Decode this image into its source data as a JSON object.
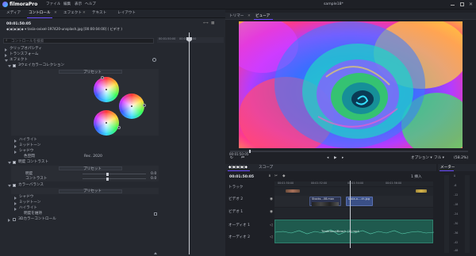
{
  "app": {
    "logo_text": "filmoraPro",
    "menu": [
      "ファイル",
      "編集",
      "表示",
      "ヘルプ"
    ],
    "project_name": "sample18*"
  },
  "left_tabs": [
    "メディア",
    "コントロール",
    "エフェクト",
    "テキスト",
    "レイアウト"
  ],
  "left_tab_active": "コントロール",
  "left_time": "00:01:50:05",
  "left_subtitle": "◆|◆|◆|◆|◆  ▾  tasia-ovixel-197420-unsplash.jpg [00:00:04:00] ( ビデオ )",
  "ruler": [
    "00:01:50:00",
    "00:01:52:00"
  ],
  "search_placeholder": "コントロールを検索",
  "controls": {
    "clip_opacity": "クリップオパシティ",
    "transform": "トランスフォーム",
    "effects": "エフェクト",
    "three_way": "3ウェイカラーコレクション",
    "preset": "プリセット",
    "highlight": "ハイライト",
    "midtone": "ミッドトーン",
    "shadow": "シャドウ",
    "color_space": "色空間",
    "color_space_value": "Rec. 2020",
    "brightness_contrast": "明度 コントラスト",
    "brightness": "明度",
    "contrast": "コントラスト",
    "zero": "0.0",
    "color_balance": "カラーバランス",
    "shadow2": "シャドウ",
    "midtone2": "ミッドトーン",
    "highlight2": "ハイライト",
    "keep_brightness": "明度を維持",
    "lut": "3Dカラーコントロール"
  },
  "viewer_tabs": [
    "トリマー",
    "ビューア"
  ],
  "viewer_tab_active": "ビューア",
  "viewer_time": "00:01:50:05",
  "viewer_options": "オプション ▾",
  "viewer_full": "フル ▾",
  "viewer_zoom": "(58.2%)",
  "timeline": {
    "tab_label": "◆|◆|◆|◆|◆",
    "scope": "スコープ",
    "time": "00:01:50:05",
    "cut_label": "1 挿入",
    "ruler": [
      "00:01:50:00",
      "00:01:52:00",
      "00:01:54:00",
      "00:01:56:00"
    ],
    "tracks": [
      {
        "name": "トラック"
      },
      {
        "name": "ビデオ 2"
      },
      {
        "name": "ビデオ 1"
      },
      {
        "name": "オーディオ 1"
      },
      {
        "name": "オーディオ 2"
      }
    ],
    "clip_video2_a": "Stocks...08.mov",
    "clip_video2_b": "tasia-o....ch.jpg",
    "audio_clip_label": "TraditionalBeach (1).mp4"
  },
  "meter": {
    "title": "メーター",
    "scale": [
      "0",
      "-6",
      "-12",
      "-18",
      "-24",
      "-30",
      "-36",
      "-42",
      "-48"
    ]
  },
  "colors": {
    "accent": "#6a4cff",
    "video_clip": "#3a4f86",
    "audio_clip": "#1f5a4e"
  }
}
